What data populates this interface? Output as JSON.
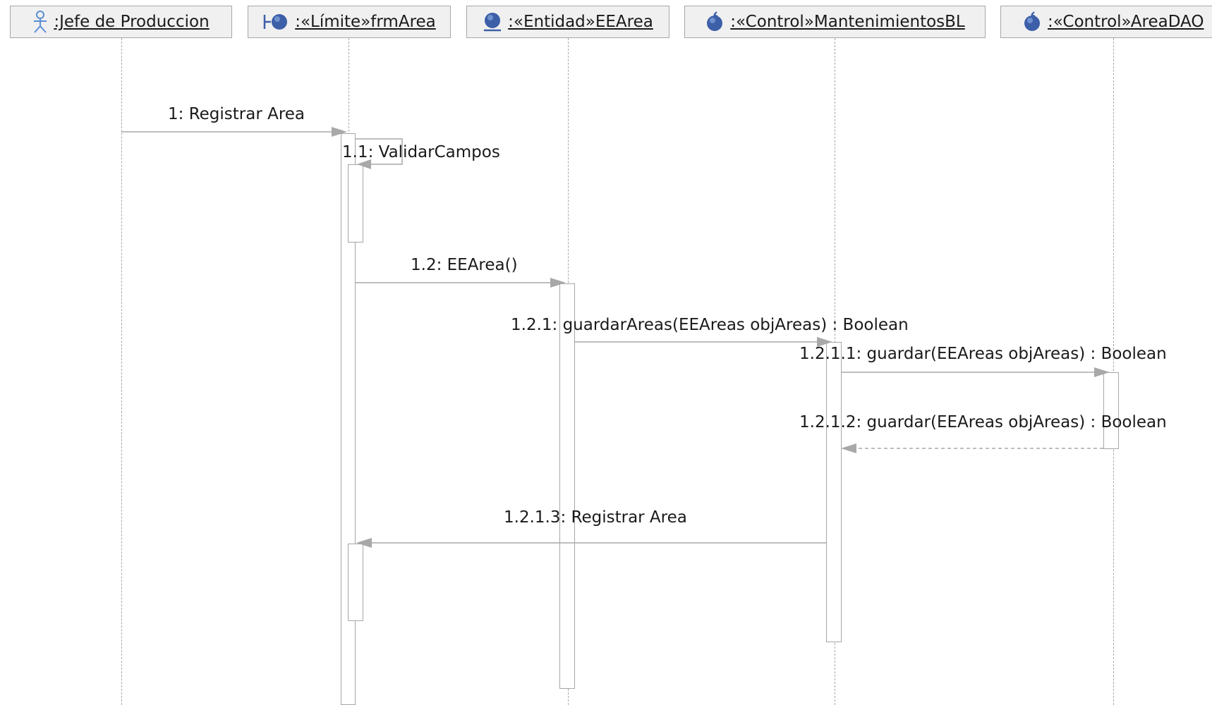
{
  "lifelines": [
    {
      "label": ":Jefe de Produccion",
      "icon": "actor-icon"
    },
    {
      "label": ":«Límite»frmArea",
      "icon": "boundary-icon"
    },
    {
      "label": ":«Entidad»EEArea",
      "icon": "entity-icon"
    },
    {
      "label": ":«Control»MantenimientosBL",
      "icon": "control-icon"
    },
    {
      "label": ":«Control»AreaDAO",
      "icon": "control-icon"
    }
  ],
  "messages": [
    {
      "label": "1: Registrar Area",
      "type": "sync"
    },
    {
      "label": "1.1: ValidarCampos",
      "type": "self"
    },
    {
      "label": "1.2: EEArea()",
      "type": "sync"
    },
    {
      "label": "1.2.1: guardarAreas(EEAreas objAreas) : Boolean",
      "type": "sync"
    },
    {
      "label": "1.2.1.1: guardar(EEAreas objAreas) : Boolean",
      "type": "sync"
    },
    {
      "label": "1.2.1.2: guardar(EEAreas objAreas) : Boolean",
      "type": "reply"
    },
    {
      "label": "1.2.1.3: Registrar Area",
      "type": "sync"
    }
  ],
  "colors": {
    "actor": "#5b8ed6",
    "boundary": "#3c5fa8",
    "entity": "#3c5fa8",
    "control": "#3c5fa8",
    "line": "#a8a8a8",
    "header_bg": "#f0f0f0"
  }
}
